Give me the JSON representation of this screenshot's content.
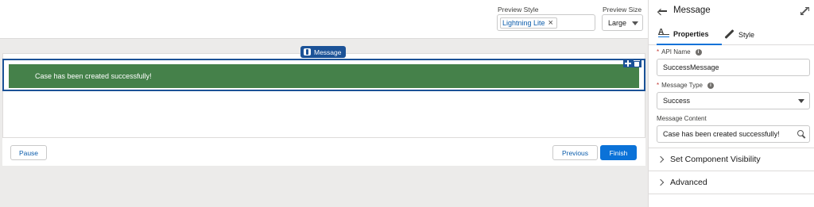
{
  "preview": {
    "style_label": "Preview Style",
    "style_value": "Lightning Lite",
    "size_label": "Preview Size",
    "size_value": "Large"
  },
  "canvas": {
    "component_tag": "Message",
    "message_text": "Case has been created successfully!",
    "footer": {
      "pause_label": "Pause",
      "previous_label": "Previous",
      "finish_label": "Finish"
    }
  },
  "panel": {
    "title": "Message",
    "tabs": [
      {
        "label": "Properties",
        "icon": "properties-icon",
        "active": true
      },
      {
        "label": "Style",
        "icon": "brush-icon",
        "active": false
      }
    ],
    "fields": {
      "api_name_label": "API Name",
      "api_name_value": "SuccessMessage",
      "message_type_label": "Message Type",
      "message_type_value": "Success",
      "message_content_label": "Message Content",
      "message_content_value": "Case has been created successfully!"
    },
    "sections": [
      {
        "label": "Set Component Visibility"
      },
      {
        "label": "Advanced"
      }
    ]
  },
  "colors": {
    "success_banner": "#45814a",
    "selection_blue": "#1b5297",
    "brand_button": "#0b72d8",
    "canvas_bg": "#ecebea"
  }
}
